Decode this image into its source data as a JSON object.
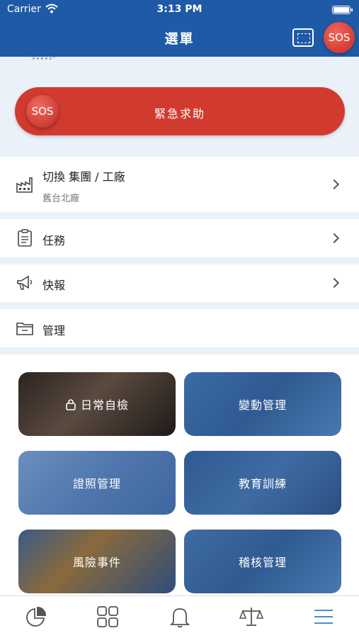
{
  "status_bar": {
    "carrier": "Carrier",
    "time": "3:13 PM"
  },
  "header": {
    "title": "選單",
    "scan_icon": "scan-frame-icon",
    "sos_label": "SOS"
  },
  "sos_bar": {
    "knob_label": "SOS",
    "label": "緊急求助"
  },
  "menu": {
    "switch": {
      "title": "切換 集團 / 工廠",
      "subtitle": "舊台北廠"
    },
    "task": {
      "title": "任務"
    },
    "news": {
      "title": "快報"
    },
    "manage": {
      "title": "管理"
    }
  },
  "tiles": [
    {
      "label": "日常自檢",
      "locked": true
    },
    {
      "label": "變動管理"
    },
    {
      "label": "證照管理"
    },
    {
      "label": "教育訓練"
    },
    {
      "label": "風險事件"
    },
    {
      "label": "稽核管理"
    }
  ],
  "tabbar": {
    "items": [
      "pie-chart-icon",
      "grid-icon",
      "bell-icon",
      "scale-icon",
      "menu-icon"
    ],
    "active": "menu-icon"
  },
  "colors": {
    "primary": "#1e5aa6",
    "sos": "#d13a2f",
    "accent": "#4a8cd6"
  }
}
